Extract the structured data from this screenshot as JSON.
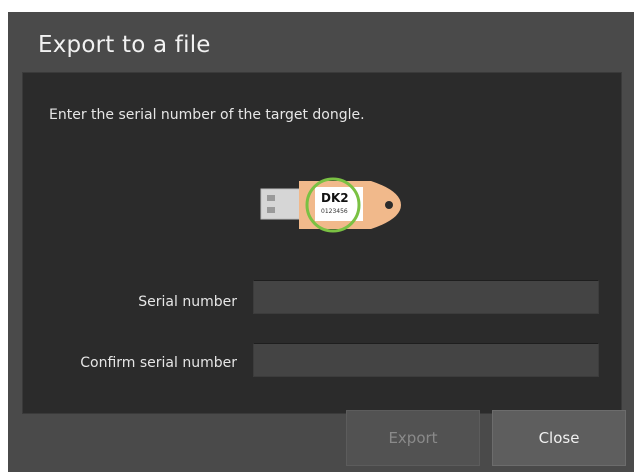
{
  "dialog": {
    "title": "Export to a file",
    "instruction": "Enter the serial number of the target dongle.",
    "dongle": {
      "model": "DK2",
      "serial": "0123456",
      "highlight_color": "#7ac143",
      "body_color": "#f1b98b"
    },
    "fields": {
      "serial_label": "Serial number",
      "serial_value": "",
      "confirm_label": "Confirm serial number",
      "confirm_value": ""
    },
    "buttons": {
      "export_label": "Export",
      "close_label": "Close"
    }
  }
}
